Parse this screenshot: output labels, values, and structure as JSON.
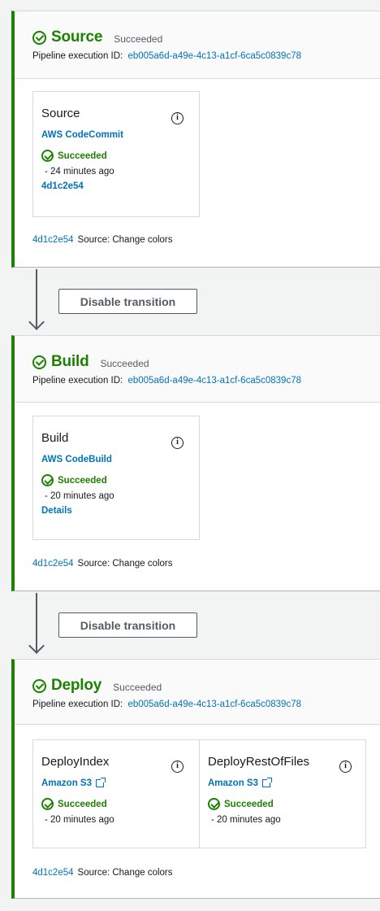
{
  "exec_label": "Pipeline execution ID:",
  "colors": {
    "success": "#1d8102",
    "link": "#0073bb",
    "stage_border": "#1d8102"
  },
  "stages": [
    {
      "name": "Source",
      "status": "Succeeded",
      "execution_id": "eb005a6d-a49e-4c13-a1cf-6ca5c0839c78",
      "actions": [
        {
          "name": "Source",
          "provider": "AWS CodeCommit",
          "status": "Succeeded",
          "time": "- 24 minutes ago",
          "link": "4d1c2e54"
        }
      ],
      "revision": {
        "id": "4d1c2e54",
        "message": "Source: Change colors"
      }
    },
    {
      "name": "Build",
      "status": "Succeeded",
      "execution_id": "eb005a6d-a49e-4c13-a1cf-6ca5c0839c78",
      "actions": [
        {
          "name": "Build",
          "provider": "AWS CodeBuild",
          "status": "Succeeded",
          "time": "- 20 minutes ago",
          "link": "Details"
        }
      ],
      "revision": {
        "id": "4d1c2e54",
        "message": "Source: Change colors"
      }
    },
    {
      "name": "Deploy",
      "status": "Succeeded",
      "execution_id": "eb005a6d-a49e-4c13-a1cf-6ca5c0839c78",
      "actions": [
        {
          "name": "DeployIndex",
          "provider": "Amazon S3",
          "status": "Succeeded",
          "time": "- 20 minutes ago"
        },
        {
          "name": "DeployRestOfFiles",
          "provider": "Amazon S3",
          "status": "Succeeded",
          "time": "- 20 minutes ago"
        }
      ],
      "revision": {
        "id": "4d1c2e54",
        "message": "Source: Change colors"
      }
    }
  ],
  "transitions": [
    {
      "button_label": "Disable transition"
    },
    {
      "button_label": "Disable transition"
    }
  ]
}
